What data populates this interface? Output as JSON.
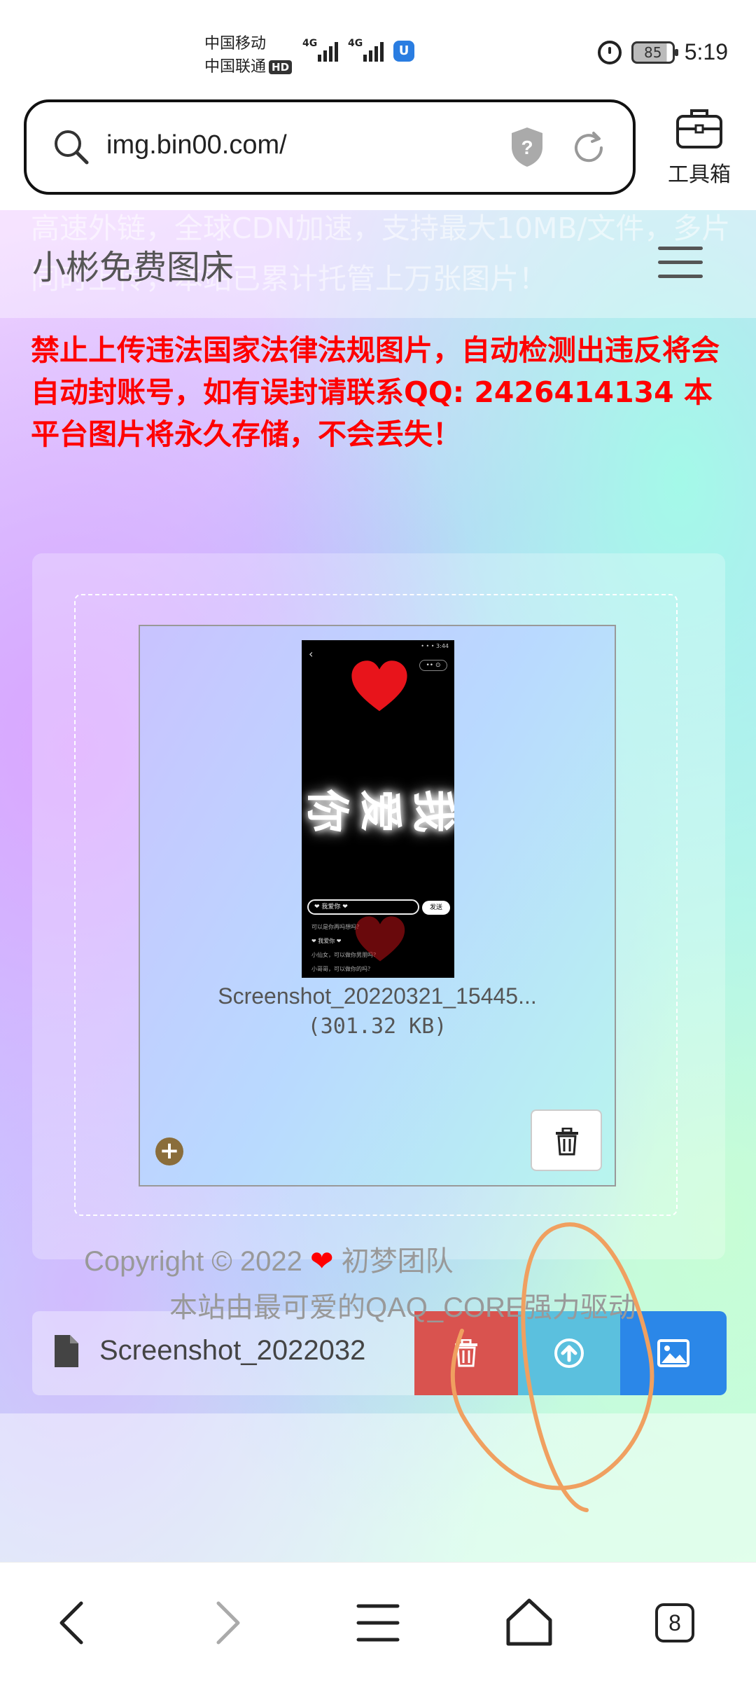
{
  "status_bar": {
    "carrier_1": "中国移动",
    "carrier_2": "中国联通",
    "hd_badge": "HD",
    "network_1": "4G",
    "network_2": "4G",
    "battery": "85",
    "time": "5:19"
  },
  "browser": {
    "url": "img.bin00.com/",
    "toolbox_label": "工具箱",
    "tab_count": "8"
  },
  "site": {
    "title": "小彬免费图床",
    "intro_text": "高速外链，全球CDN加速，支持最大10MB/文件，多片同时上传，本站已累计托管上万张图片！",
    "warning": "禁止上传违法国家法律法规图片，自动检测出违反将会自动封账号，如有误封请联系QQ: 2426414134 本平台图片将永久存储，不会丢失！"
  },
  "upload": {
    "file_name": "Screenshot_20220321_15445...",
    "file_size": "(301.32 KB)",
    "caption_file_name": "Screenshot_2022032",
    "thumbnail": {
      "big_text": "我爱你",
      "input_text": "❤ 我爱你 ❤",
      "send_label": "发送",
      "messages": [
        "可以是你再吗想吗？",
        "❤ 我爱你 ❤",
        "小仙女，可以做你男朋吗？",
        "小哥哥，可以做你的吗？"
      ]
    }
  },
  "footer": {
    "copyright_prefix": "Copyright © 2022",
    "heart": "❤",
    "team": "初梦团队",
    "powered_by": "本站由最可爱的QAQ_CORE强力驱动"
  },
  "colors": {
    "warning": "#ff0000",
    "remove_button": "#d9534f",
    "upload_button": "#5bc0de",
    "browse_button": "#2b87e8",
    "annotation_stroke": "#f0a060"
  },
  "icons": {
    "search": "search-icon",
    "shield": "shield-question-icon",
    "reload": "reload-icon",
    "toolbox": "toolbox-icon",
    "menu": "hamburger-menu-icon",
    "trash": "trash-icon",
    "upload": "upload-circle-icon",
    "image": "image-icon",
    "file": "file-icon",
    "back": "back-arrow-icon",
    "forward": "forward-arrow-icon",
    "home": "home-icon"
  }
}
